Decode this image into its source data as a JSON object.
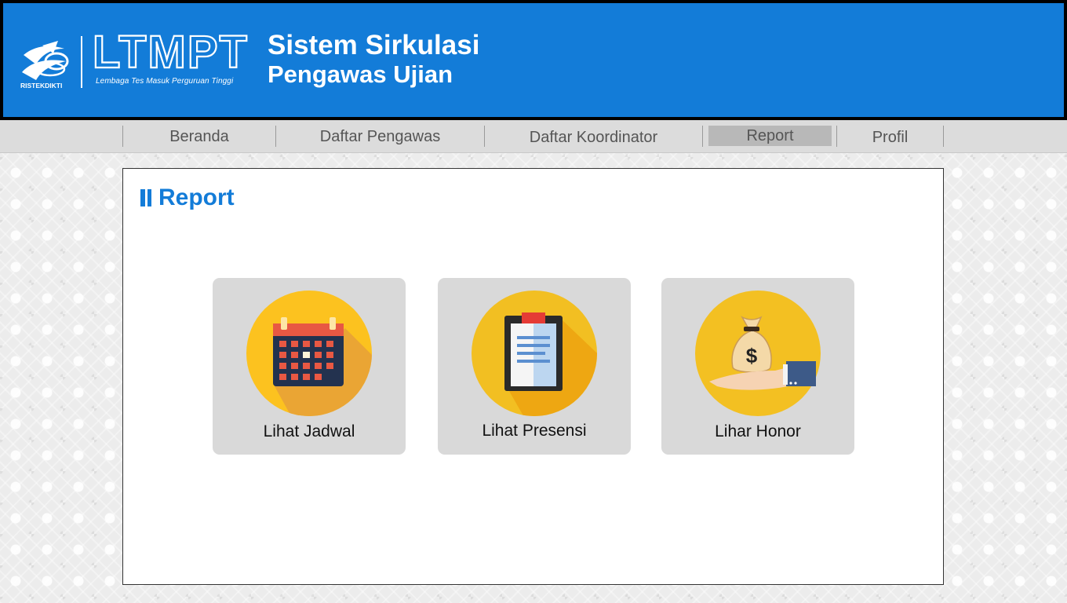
{
  "header": {
    "logo_wordmark": "LTMPT",
    "logo_tagline": "Lembaga Tes Masuk Perguruan Tinggi",
    "emblem_text": "RISTEKDIKTI",
    "title_line1": "Sistem Sirkulasi",
    "title_line2": "Pengawas Ujian",
    "brand_color": "#137cd8"
  },
  "nav": {
    "items": [
      {
        "label": "Beranda",
        "active": false
      },
      {
        "label": "Daftar Pengawas",
        "active": false
      },
      {
        "label": "Daftar Koordinator",
        "active": false
      },
      {
        "label": "Report",
        "active": true
      },
      {
        "label": "Profil",
        "active": false
      }
    ]
  },
  "main": {
    "title": "Report",
    "cards": [
      {
        "label": "Lihat Jadwal",
        "icon": "calendar-icon"
      },
      {
        "label": "Lihat Presensi",
        "icon": "clipboard-icon"
      },
      {
        "label": "Lihar Honor",
        "icon": "money-bag-icon"
      }
    ]
  }
}
